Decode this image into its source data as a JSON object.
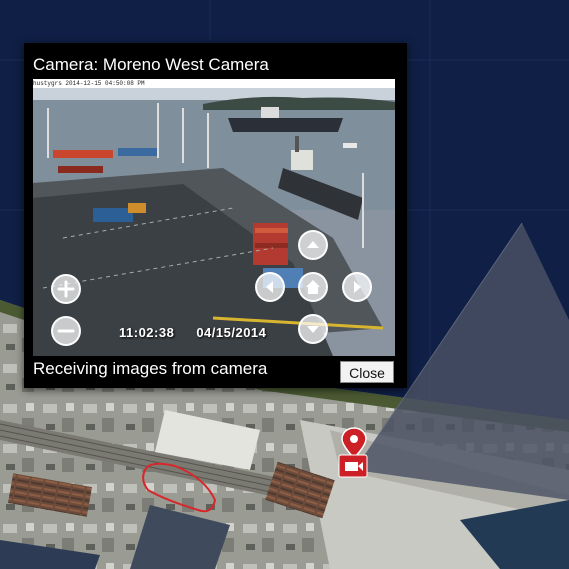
{
  "popup": {
    "title": "Camera: Moreno West Camera",
    "feed_header": "hustygrs 2014-12-15 04:50:08 PM",
    "time": "11:02:38",
    "date": "04/15/2014",
    "status": "Receiving images from camera",
    "close_label": "Close"
  },
  "controls": {
    "zoom_in": "plus-icon",
    "zoom_out": "minus-icon",
    "pan_up": "chevron-up-icon",
    "pan_down": "chevron-down-icon",
    "pan_left": "chevron-left-icon",
    "pan_right": "chevron-right-icon",
    "home": "home-icon"
  },
  "map": {
    "marker_icon": "camera-marker-icon",
    "colors": {
      "background": "#0f1f45",
      "viewshed": "#4a5264",
      "marker": "#cc2026",
      "zone_outline": "#d8272b"
    }
  }
}
